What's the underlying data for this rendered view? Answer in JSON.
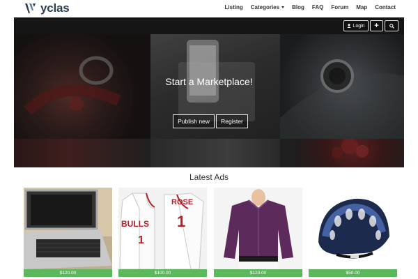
{
  "brand": {
    "name": "yclas"
  },
  "nav": {
    "items": [
      "Listing",
      "Categories",
      "Blog",
      "FAQ",
      "Forum",
      "Map",
      "Contact"
    ]
  },
  "hero": {
    "login_label": "Login",
    "title": "Start a Marketplace!",
    "publish_label": "Publish new",
    "register_label": "Register"
  },
  "latest": {
    "title": "Latest Ads",
    "ads": [
      {
        "image": "laptop",
        "price": "$120.00"
      },
      {
        "image": "basketball-jersey",
        "price": "$100.00"
      },
      {
        "image": "purple-shirt",
        "price": "$123.00"
      },
      {
        "image": "bicycle-helmet",
        "price": "$50.00"
      }
    ]
  },
  "colors": {
    "brand_text": "#2c3e50",
    "price_bar": "#5cb85c",
    "hero_bar": "#151515"
  }
}
